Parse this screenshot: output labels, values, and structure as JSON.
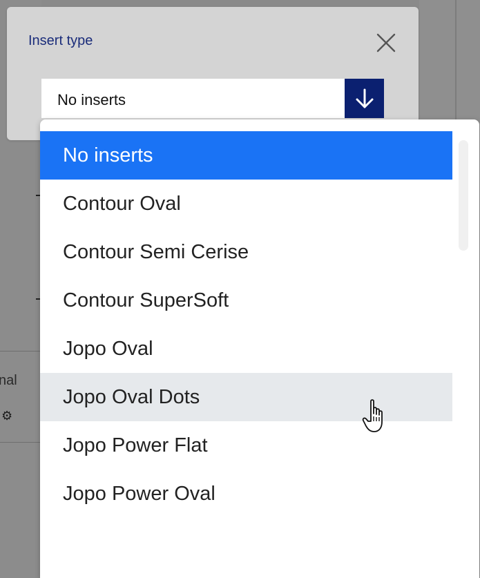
{
  "dialog": {
    "title": "Insert type",
    "selected_value": "No inserts"
  },
  "dropdown": {
    "options": [
      {
        "label": "No inserts",
        "state": "selected"
      },
      {
        "label": "Contour Oval",
        "state": "normal"
      },
      {
        "label": "Contour Semi Cerise",
        "state": "normal"
      },
      {
        "label": "Contour SuperSoft",
        "state": "normal"
      },
      {
        "label": "Jopo Oval",
        "state": "normal"
      },
      {
        "label": "Jopo Oval Dots",
        "state": "hovered"
      },
      {
        "label": "Jopo Power Flat",
        "state": "normal"
      },
      {
        "label": "Jopo Power Oval",
        "state": "normal"
      }
    ]
  },
  "background": {
    "partial_text": "nal"
  },
  "colors": {
    "accent": "#1a73f5",
    "arrow_button": "#0b2070",
    "title": "#1a2c7a",
    "hover": "#e6e9ec"
  },
  "icons": {
    "close": "close-icon",
    "arrow": "arrow-down-icon",
    "cursor": "hand-pointer-icon"
  }
}
